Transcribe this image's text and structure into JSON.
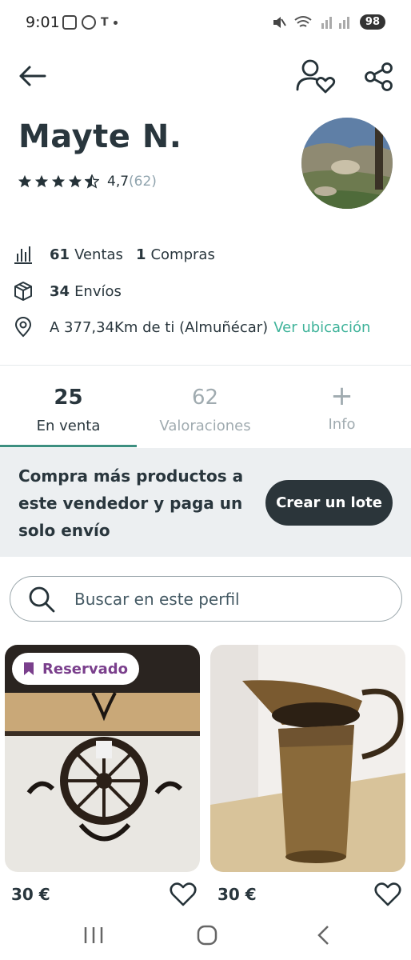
{
  "status_bar": {
    "time": "9:01",
    "battery": "98"
  },
  "seller": {
    "name": "Mayte N.",
    "rating_value": "4,7",
    "rating_count": "(62)",
    "stars": 4.5
  },
  "stats": {
    "sales_count": "61",
    "sales_label": "Ventas",
    "purchases_count": "1",
    "purchases_label": "Compras",
    "shipments_count": "34",
    "shipments_label": "Envíos",
    "location_text": "A 377,34Km de ti (Almuñécar)",
    "location_link": "Ver ubicación"
  },
  "tabs": [
    {
      "num": "25",
      "label": "En venta"
    },
    {
      "num": "62",
      "label": "Valoraciones"
    },
    {
      "num": "+",
      "label": "Info"
    }
  ],
  "promo": {
    "text": "Compra más productos a este vendedor y paga un solo envío",
    "button": "Crear un lote"
  },
  "search": {
    "placeholder": "Buscar en este perfil"
  },
  "products": [
    {
      "badge": "Reservado",
      "price": "30 €",
      "icon": "chandelier-image"
    },
    {
      "badge": "",
      "price": "30 €",
      "icon": "copper-jug-image"
    }
  ],
  "colors": {
    "accent": "#3fb39a",
    "tab_indicator": "#3c8f80",
    "dark": "#29363d",
    "reserved": "#7a3f8c"
  }
}
